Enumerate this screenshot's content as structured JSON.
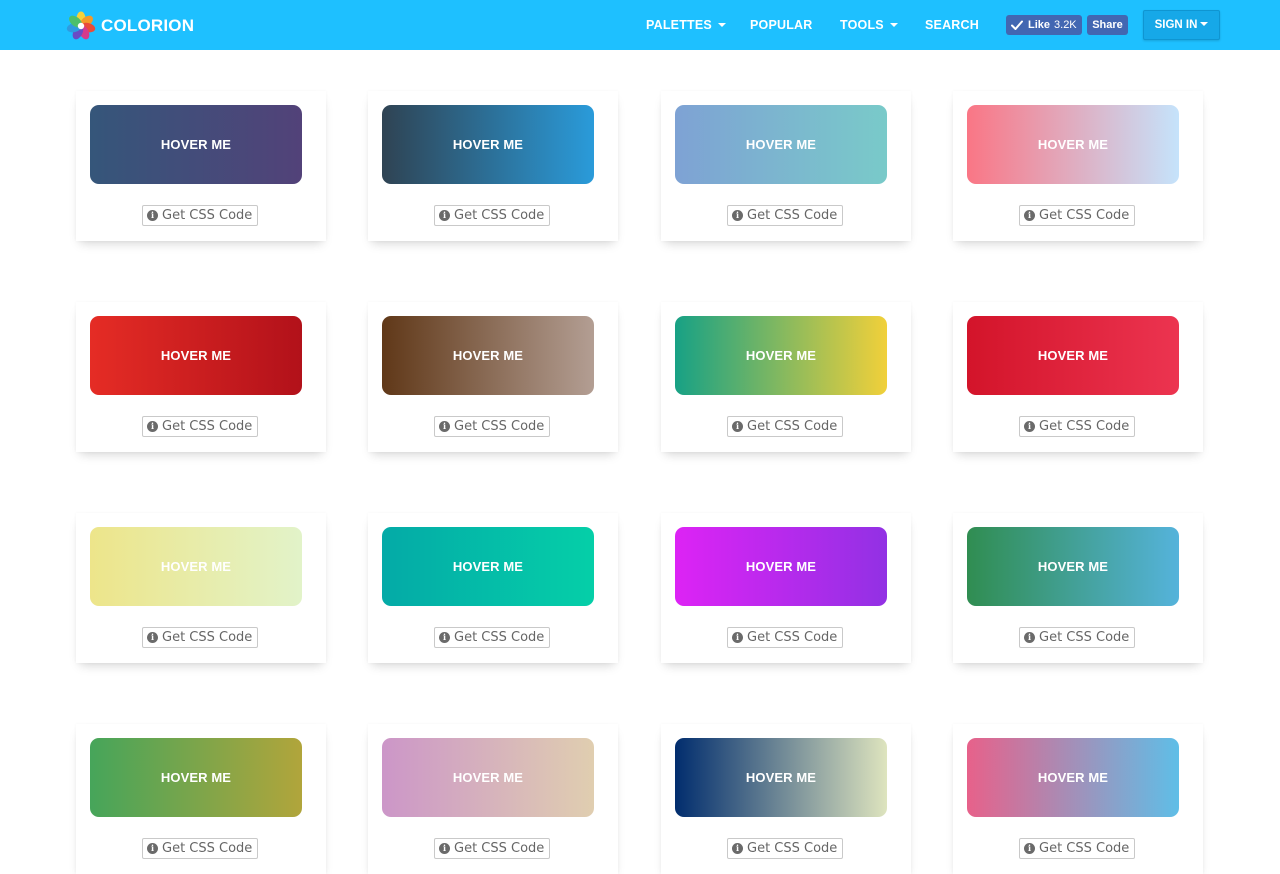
{
  "header": {
    "brand": "COLORION",
    "nav": [
      {
        "label": "PALETTES",
        "dropdown": true
      },
      {
        "label": "POPULAR",
        "dropdown": false
      },
      {
        "label": "TOOLS",
        "dropdown": true
      },
      {
        "label": "SEARCH",
        "dropdown": false
      }
    ],
    "like_label": "Like",
    "like_count": "3.2K",
    "share_label": "Share",
    "signin_label": "SIGN IN"
  },
  "colors": {
    "navbar": "#1ec0ff",
    "facebook": "#4267b2"
  },
  "cards": [
    {
      "button_label": "HOVER ME",
      "code_label": "Get CSS Code",
      "gradient": [
        "#35567a",
        "#524279"
      ]
    },
    {
      "button_label": "HOVER ME",
      "code_label": "Get CSS Code",
      "gradient": [
        "#2f4353",
        "#2a9bda"
      ]
    },
    {
      "button_label": "HOVER ME",
      "code_label": "Get CSS Code",
      "gradient": [
        "#7ea2d4",
        "#79cac9"
      ]
    },
    {
      "button_label": "HOVER ME",
      "code_label": "Get CSS Code",
      "gradient": [
        "#fa7685",
        "#c5e3fb"
      ]
    },
    {
      "button_label": "HOVER ME",
      "code_label": "Get CSS Code",
      "gradient": [
        "#e52c25",
        "#b2111a"
      ]
    },
    {
      "button_label": "HOVER ME",
      "code_label": "Get CSS Code",
      "gradient": [
        "#603818",
        "#b39e93"
      ]
    },
    {
      "button_label": "HOVER ME",
      "code_label": "Get CSS Code",
      "gradient": [
        "#17a185",
        "#f1d03a"
      ]
    },
    {
      "button_label": "HOVER ME",
      "code_label": "Get CSS Code",
      "gradient": [
        "#d3142a",
        "#ec3450"
      ]
    },
    {
      "button_label": "HOVER ME",
      "code_label": "Get CSS Code",
      "gradient": [
        "#ede58a",
        "#e2f3c9"
      ]
    },
    {
      "button_label": "HOVER ME",
      "code_label": "Get CSS Code",
      "gradient": [
        "#04aaa7",
        "#05cfa8"
      ]
    },
    {
      "button_label": "HOVER ME",
      "code_label": "Get CSS Code",
      "gradient": [
        "#dd23f5",
        "#9231e4"
      ]
    },
    {
      "button_label": "HOVER ME",
      "code_label": "Get CSS Code",
      "gradient": [
        "#308d51",
        "#55b3db"
      ]
    },
    {
      "button_label": "HOVER ME",
      "code_label": "Get CSS Code",
      "gradient": [
        "#46a55a",
        "#b1a53b"
      ]
    },
    {
      "button_label": "HOVER ME",
      "code_label": "Get CSS Code",
      "gradient": [
        "#cc96c8",
        "#e0ceb0"
      ]
    },
    {
      "button_label": "HOVER ME",
      "code_label": "Get CSS Code",
      "gradient": [
        "#012d6e",
        "#dee4be"
      ]
    },
    {
      "button_label": "HOVER ME",
      "code_label": "Get CSS Code",
      "gradient": [
        "#e7618a",
        "#5fbee7"
      ]
    }
  ]
}
